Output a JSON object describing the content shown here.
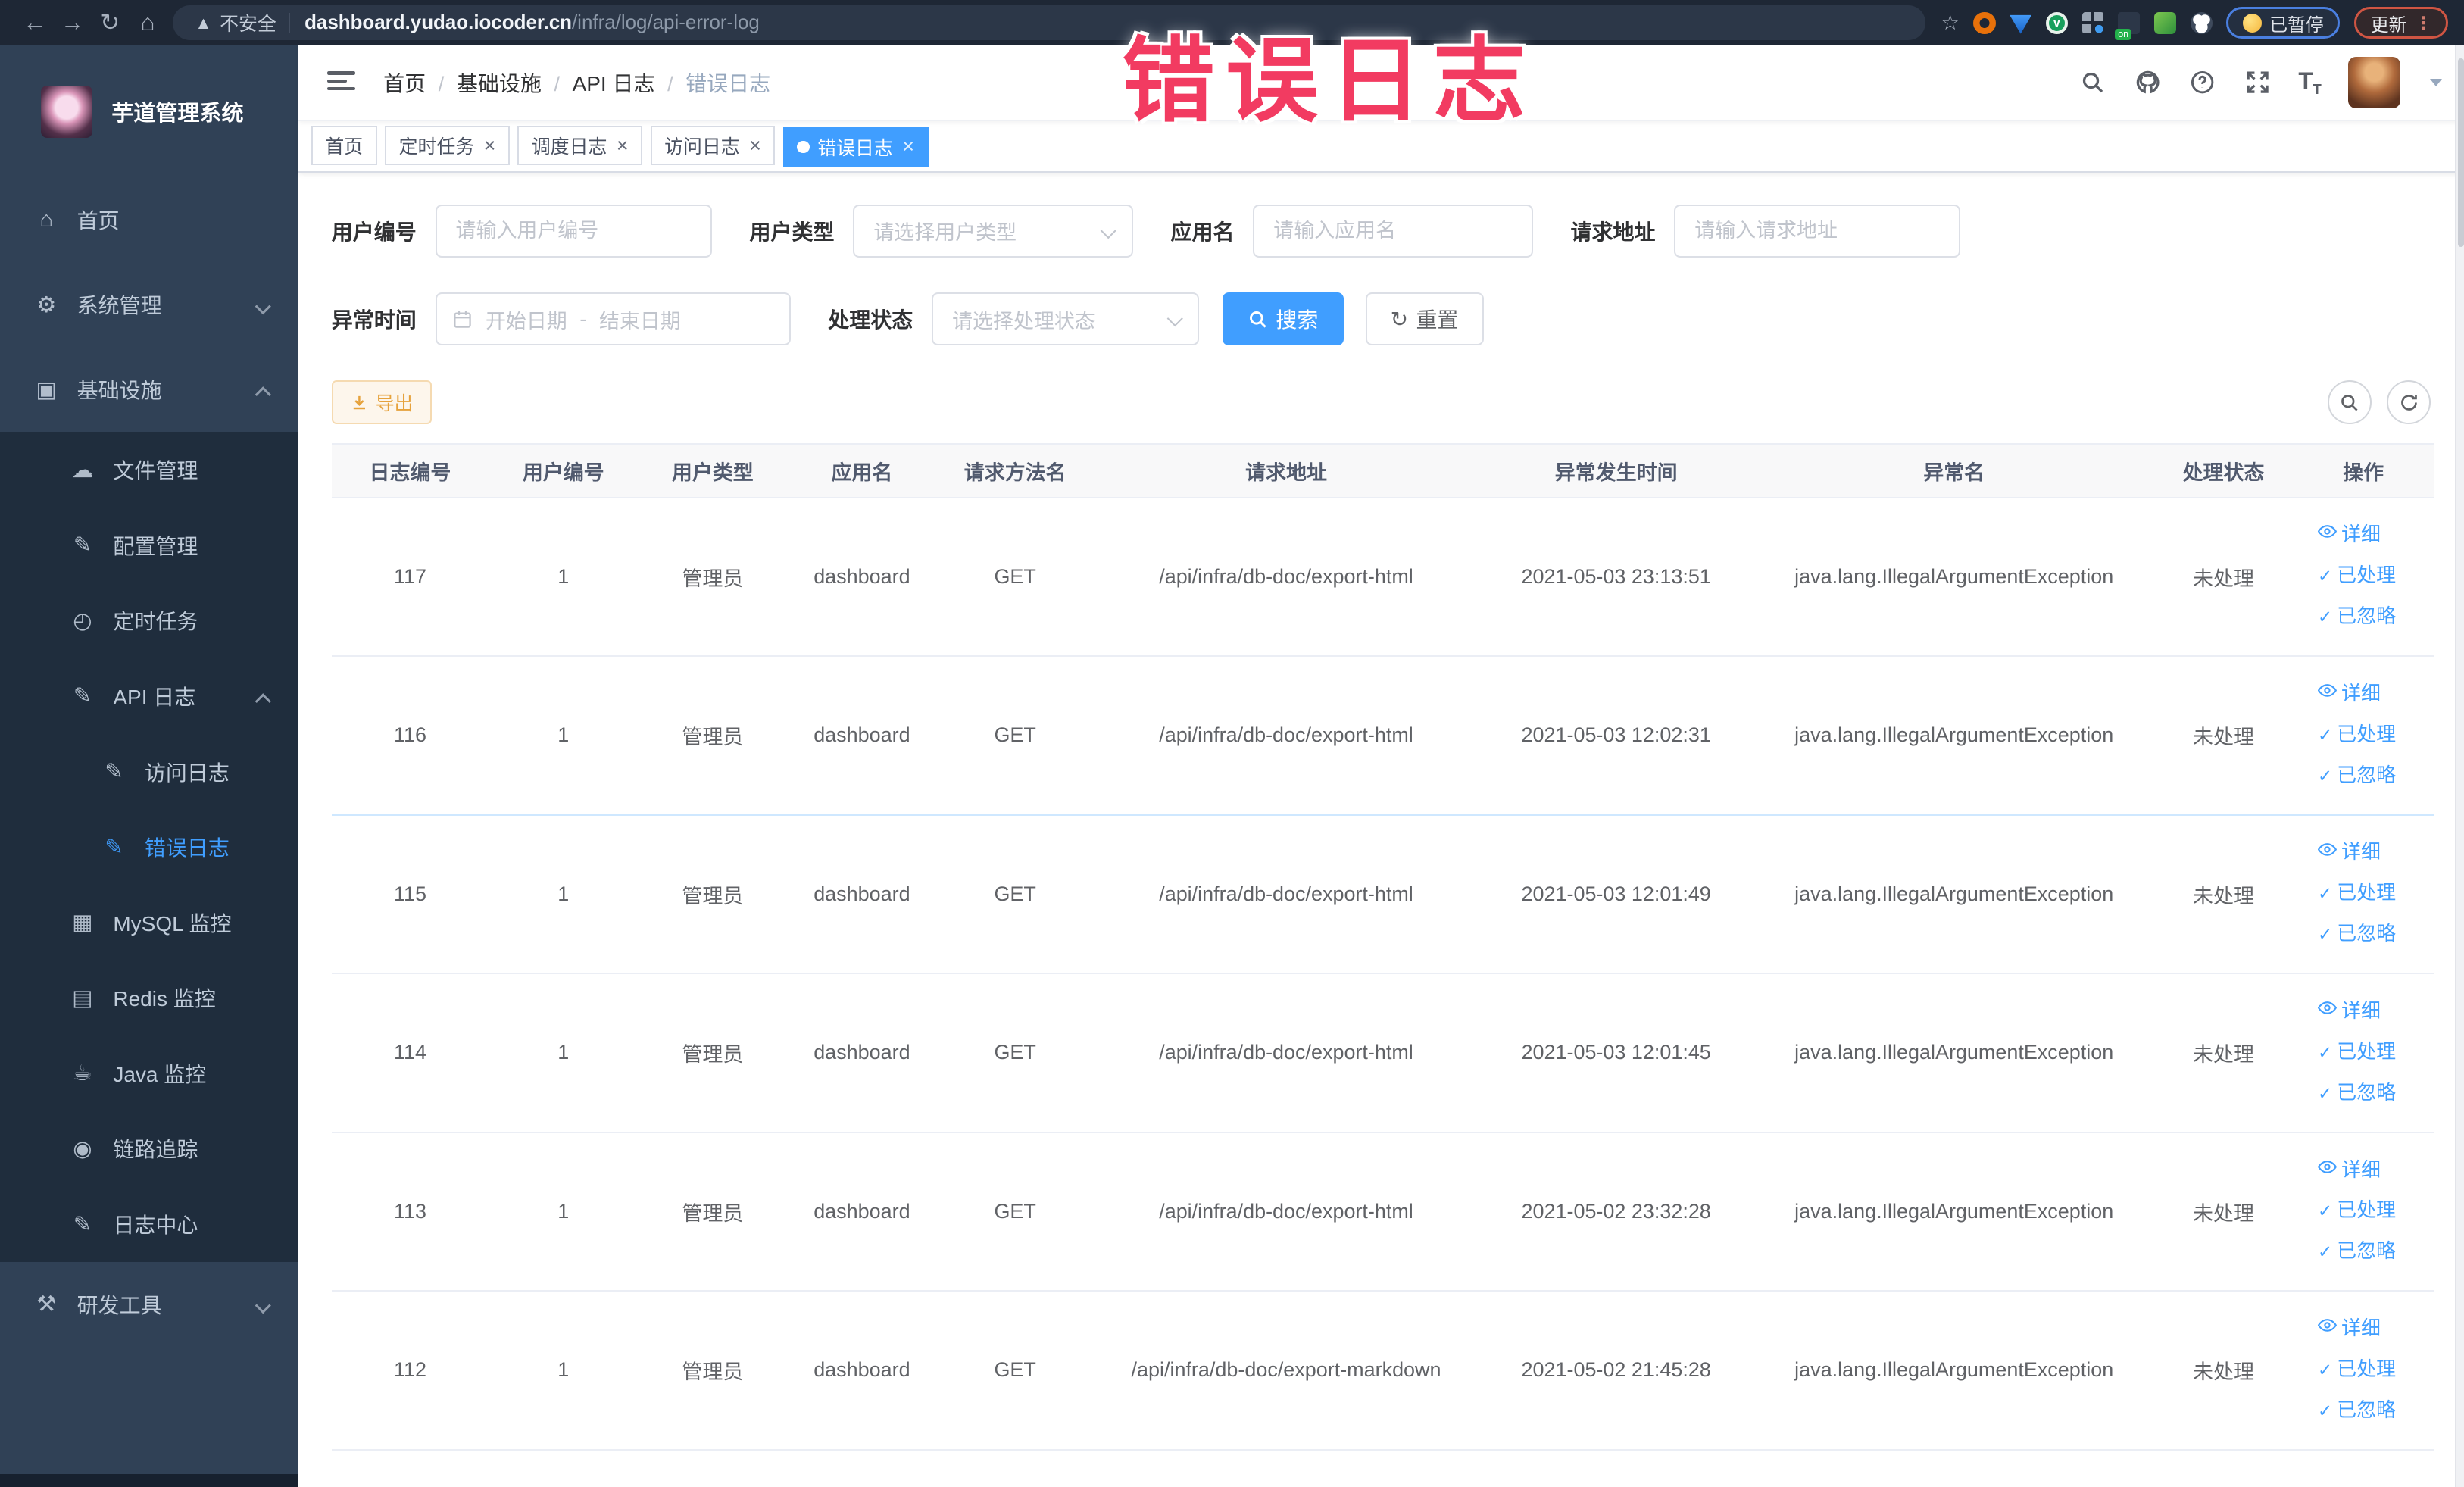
{
  "colors": {
    "accent": "#409eff",
    "warning": "#e6a23c",
    "annotation": "#f23b61",
    "sidebar_bg": "#304156",
    "sidebar_sub_bg": "#1f2d3d"
  },
  "annotation": {
    "text": "错误日志"
  },
  "browser": {
    "security_label": "不安全",
    "url_domain": "dashboard.yudao.iocoder.cn",
    "url_path": "/infra/log/api-error-log",
    "paused_badge": "已暂停",
    "update_badge": "更新"
  },
  "sidebar": {
    "logo_title": "芋道管理系统",
    "items": [
      {
        "id": "home",
        "label": "首页",
        "icon": "home-icon",
        "level": 0,
        "dark": false,
        "chevron": "",
        "active": false
      },
      {
        "id": "system",
        "label": "系统管理",
        "icon": "gear-icon",
        "level": 0,
        "dark": false,
        "chevron": "down",
        "active": false
      },
      {
        "id": "infra",
        "label": "基础设施",
        "icon": "monitor-icon",
        "level": 0,
        "dark": false,
        "chevron": "up",
        "active": false
      },
      {
        "id": "file",
        "label": "文件管理",
        "icon": "cloud-icon",
        "level": 1,
        "dark": true,
        "chevron": "",
        "active": false
      },
      {
        "id": "config",
        "label": "配置管理",
        "icon": "edit-icon",
        "level": 1,
        "dark": true,
        "chevron": "",
        "active": false
      },
      {
        "id": "job",
        "label": "定时任务",
        "icon": "clock-icon",
        "level": 1,
        "dark": true,
        "chevron": "",
        "active": false
      },
      {
        "id": "apilog",
        "label": "API 日志",
        "icon": "log-icon",
        "level": 1,
        "dark": true,
        "chevron": "up",
        "active": false
      },
      {
        "id": "accesslog",
        "label": "访问日志",
        "icon": "log-icon",
        "level": 2,
        "dark": true,
        "chevron": "",
        "active": false
      },
      {
        "id": "errorlog",
        "label": "错误日志",
        "icon": "log-icon",
        "level": 2,
        "dark": true,
        "chevron": "",
        "active": true
      },
      {
        "id": "mysql",
        "label": "MySQL 监控",
        "icon": "mysql-icon",
        "level": 1,
        "dark": true,
        "chevron": "",
        "active": false
      },
      {
        "id": "redis",
        "label": "Redis 监控",
        "icon": "redis-icon",
        "level": 1,
        "dark": true,
        "chevron": "",
        "active": false
      },
      {
        "id": "java",
        "label": "Java 监控",
        "icon": "coffee-icon",
        "level": 1,
        "dark": true,
        "chevron": "",
        "active": false
      },
      {
        "id": "trace",
        "label": "链路追踪",
        "icon": "eye-icon",
        "level": 1,
        "dark": true,
        "chevron": "",
        "active": false
      },
      {
        "id": "logcenter",
        "label": "日志中心",
        "icon": "log-icon",
        "level": 1,
        "dark": true,
        "chevron": "",
        "active": false
      },
      {
        "id": "devtools",
        "label": "研发工具",
        "icon": "toolbox-icon",
        "level": 0,
        "dark": false,
        "chevron": "down",
        "active": false
      }
    ]
  },
  "header": {
    "breadcrumb": [
      "首页",
      "基础设施",
      "API 日志",
      "错误日志"
    ]
  },
  "tabs": [
    {
      "id": "home",
      "label": "首页",
      "closable": false,
      "active": false
    },
    {
      "id": "job",
      "label": "定时任务",
      "closable": true,
      "active": false
    },
    {
      "id": "joblog",
      "label": "调度日志",
      "closable": true,
      "active": false
    },
    {
      "id": "accesslog",
      "label": "访问日志",
      "closable": true,
      "active": false
    },
    {
      "id": "errorlog",
      "label": "错误日志",
      "closable": true,
      "active": true
    }
  ],
  "filters": {
    "user_id_label": "用户编号",
    "user_id_placeholder": "请输入用户编号",
    "user_type_label": "用户类型",
    "user_type_placeholder": "请选择用户类型",
    "app_name_label": "应用名",
    "app_name_placeholder": "请输入应用名",
    "request_url_label": "请求地址",
    "request_url_placeholder": "请输入请求地址",
    "exception_time_label": "异常时间",
    "date_start_placeholder": "开始日期",
    "date_separator": "-",
    "date_end_placeholder": "结束日期",
    "process_status_label": "处理状态",
    "process_status_placeholder": "请选择处理状态",
    "search_label": "搜索",
    "reset_label": "重置"
  },
  "toolbar": {
    "export_label": "导出"
  },
  "table": {
    "columns": [
      "日志编号",
      "用户编号",
      "用户类型",
      "应用名",
      "请求方法名",
      "请求地址",
      "异常发生时间",
      "异常名",
      "处理状态",
      "操作"
    ],
    "actions": [
      "详细",
      "已处理",
      "已忽略"
    ],
    "rows": [
      {
        "id": "117",
        "user_id": "1",
        "user_type": "管理员",
        "app_name": "dashboard",
        "method": "GET",
        "url": "/api/infra/db-doc/export-html",
        "time": "2021-05-03 23:13:51",
        "exception": "java.lang.IllegalArgumentException",
        "status": "未处理"
      },
      {
        "id": "116",
        "user_id": "1",
        "user_type": "管理员",
        "app_name": "dashboard",
        "method": "GET",
        "url": "/api/infra/db-doc/export-html",
        "time": "2021-05-03 12:02:31",
        "exception": "java.lang.IllegalArgumentException",
        "status": "未处理"
      },
      {
        "id": "115",
        "user_id": "1",
        "user_type": "管理员",
        "app_name": "dashboard",
        "method": "GET",
        "url": "/api/infra/db-doc/export-html",
        "time": "2021-05-03 12:01:49",
        "exception": "java.lang.IllegalArgumentException",
        "status": "未处理"
      },
      {
        "id": "114",
        "user_id": "1",
        "user_type": "管理员",
        "app_name": "dashboard",
        "method": "GET",
        "url": "/api/infra/db-doc/export-html",
        "time": "2021-05-03 12:01:45",
        "exception": "java.lang.IllegalArgumentException",
        "status": "未处理"
      },
      {
        "id": "113",
        "user_id": "1",
        "user_type": "管理员",
        "app_name": "dashboard",
        "method": "GET",
        "url": "/api/infra/db-doc/export-html",
        "time": "2021-05-02 23:32:28",
        "exception": "java.lang.IllegalArgumentException",
        "status": "未处理"
      },
      {
        "id": "112",
        "user_id": "1",
        "user_type": "管理员",
        "app_name": "dashboard",
        "method": "GET",
        "url": "/api/infra/db-doc/export-markdown",
        "time": "2021-05-02 21:45:28",
        "exception": "java.lang.IllegalArgumentException",
        "status": "未处理"
      }
    ]
  }
}
